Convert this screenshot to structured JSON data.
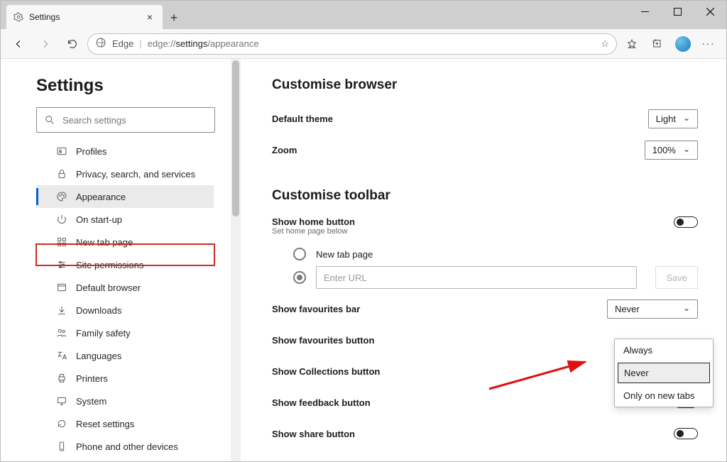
{
  "tab": {
    "title": "Settings"
  },
  "toolbar": {
    "product": "Edge",
    "url_prefix": "edge://",
    "url_bold": "settings",
    "url_rest": "/appearance"
  },
  "sidebar": {
    "heading": "Settings",
    "search_placeholder": "Search settings",
    "items": [
      {
        "label": "Profiles"
      },
      {
        "label": "Privacy, search, and services"
      },
      {
        "label": "Appearance"
      },
      {
        "label": "On start-up"
      },
      {
        "label": "New tab page"
      },
      {
        "label": "Site permissions"
      },
      {
        "label": "Default browser"
      },
      {
        "label": "Downloads"
      },
      {
        "label": "Family safety"
      },
      {
        "label": "Languages"
      },
      {
        "label": "Printers"
      },
      {
        "label": "System"
      },
      {
        "label": "Reset settings"
      },
      {
        "label": "Phone and other devices"
      }
    ]
  },
  "content": {
    "section1": "Customise browser",
    "theme_label": "Default theme",
    "theme_value": "Light",
    "zoom_label": "Zoom",
    "zoom_value": "100%",
    "section2": "Customise toolbar",
    "home_label": "Show home button",
    "home_sub": "Set home page below",
    "radio_newtab": "New tab page",
    "url_placeholder": "Enter URL",
    "save_label": "Save",
    "fav_bar_label": "Show favourites bar",
    "fav_bar_value": "Never",
    "fav_bar_options": [
      "Always",
      "Never",
      "Only on new tabs"
    ],
    "fav_btn_label": "Show favourites button",
    "collections_label": "Show Collections button",
    "feedback_label": "Show feedback button",
    "share_label": "Show share button"
  }
}
